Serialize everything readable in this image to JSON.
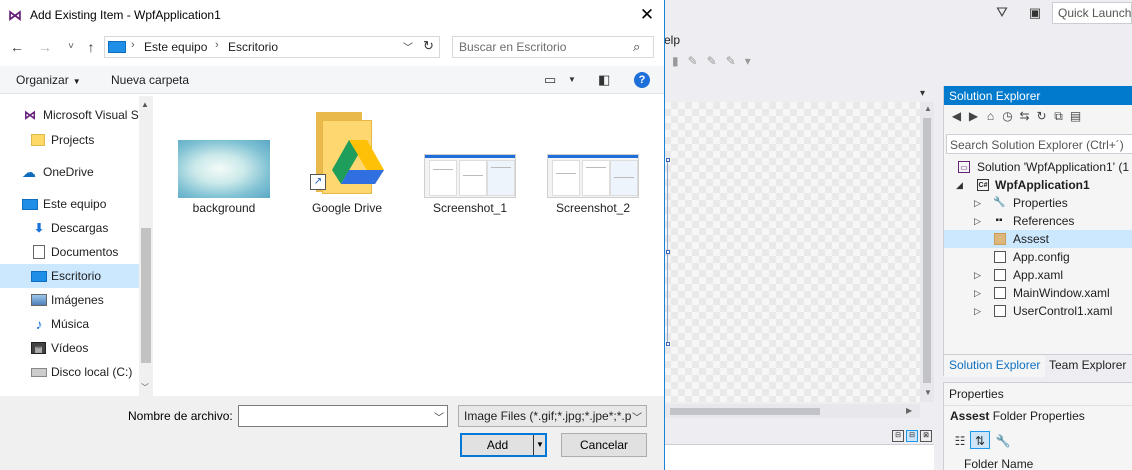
{
  "dialog": {
    "title": "Add Existing Item - WpfApplication1",
    "close_glyph": "✕",
    "nav": {
      "back": "←",
      "forward": "→",
      "recent": "˅",
      "up": "↑"
    },
    "address": {
      "segments": [
        "Este equipo",
        "Escritorio"
      ],
      "separator": "›"
    },
    "search": {
      "placeholder": "Buscar en Escritorio"
    },
    "commands": {
      "organize": "Organizar",
      "new_folder": "Nueva carpeta"
    },
    "nav_pane": {
      "items": [
        {
          "label": "Microsoft Visual S",
          "icon": "visual-studio-icon"
        },
        {
          "label": "Projects",
          "icon": "folder-icon"
        },
        {
          "label": "OneDrive",
          "icon": "cloud-icon"
        },
        {
          "label": "Este equipo",
          "icon": "computer-icon"
        },
        {
          "label": "Descargas",
          "icon": "download-icon"
        },
        {
          "label": "Documentos",
          "icon": "documents-icon"
        },
        {
          "label": "Escritorio",
          "icon": "desktop-icon",
          "selected": true
        },
        {
          "label": "Imágenes",
          "icon": "pictures-icon"
        },
        {
          "label": "Música",
          "icon": "music-icon"
        },
        {
          "label": "Vídeos",
          "icon": "videos-icon"
        },
        {
          "label": "Disco local (C:)",
          "icon": "disk-icon"
        }
      ]
    },
    "files": [
      {
        "name": "background",
        "type": "image"
      },
      {
        "name": "Google Drive",
        "type": "folder-shortcut"
      },
      {
        "name": "Screenshot_1",
        "type": "image"
      },
      {
        "name": "Screenshot_2",
        "type": "image"
      }
    ],
    "footer": {
      "filename_label": "Nombre de archivo:",
      "filename_value": "",
      "filetype": "Image Files (*.gif;*.jpg;*.jpe*;*.p",
      "add_label": "Add",
      "cancel_label": "Cancelar"
    }
  },
  "vs": {
    "quick_launch": "Quick Launch",
    "menu_partial": "elp",
    "solution_explorer": {
      "title": "Solution Explorer",
      "search_placeholder": "Search Solution Explorer (Ctrl+´)",
      "tree": [
        {
          "label": "Solution 'WpfApplication1' (1",
          "icon": "solution-icon"
        },
        {
          "label": "WpfApplication1",
          "icon": "csharp-project-icon",
          "bold": true
        },
        {
          "label": "Properties",
          "icon": "wrench-icon"
        },
        {
          "label": "References",
          "icon": "references-icon"
        },
        {
          "label": "Assest",
          "icon": "folder-icon",
          "selected": true
        },
        {
          "label": "App.config",
          "icon": "config-file-icon"
        },
        {
          "label": "App.xaml",
          "icon": "xaml-file-icon"
        },
        {
          "label": "MainWindow.xaml",
          "icon": "xaml-file-icon"
        },
        {
          "label": "UserControl1.xaml",
          "icon": "xaml-file-icon"
        }
      ],
      "tabs": [
        "Solution Explorer",
        "Team Explorer"
      ]
    },
    "properties": {
      "title": "Properties",
      "object_name": "Assest",
      "object_type": "Folder Properties",
      "row_label": "Folder Name"
    }
  },
  "colors": {
    "accent": "#007acc",
    "selection": "#cce8ff",
    "dialog_border": "#1883d7"
  }
}
